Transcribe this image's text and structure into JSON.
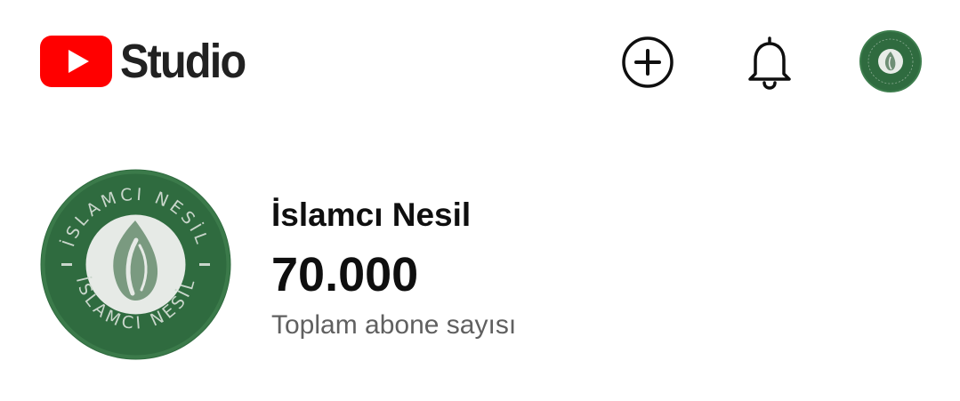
{
  "header": {
    "logo_icon": "youtube-play-icon",
    "app_name": "Studio",
    "brand_color": "#ff0000",
    "actions": [
      {
        "icon": "create-plus-icon"
      },
      {
        "icon": "notifications-bell-icon"
      },
      {
        "icon": "account-avatar"
      }
    ]
  },
  "channel": {
    "name": "İslamcı Nesil",
    "subscriber_count": "70.000",
    "subscriber_label": "Toplam abone sayısı",
    "avatar_text_top": "İSLAMCI NESİL",
    "avatar_text_bottom": "İSLAMCI NESİL",
    "avatar_color": "#2f6b3f"
  }
}
